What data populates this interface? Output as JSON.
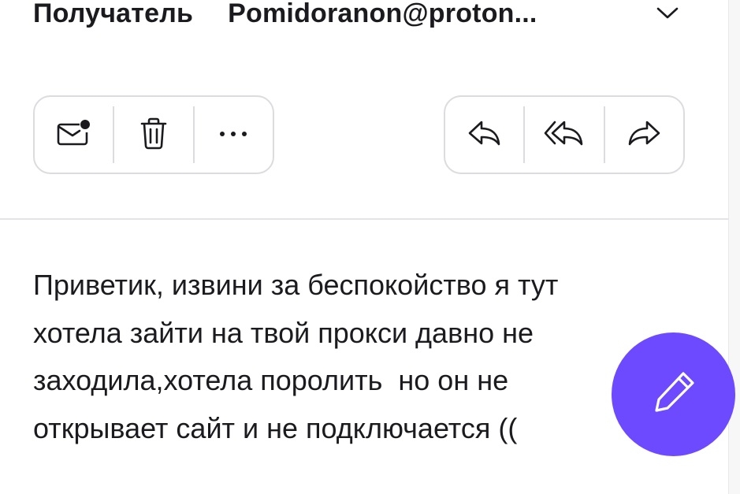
{
  "header": {
    "recipient_label": "Получатель",
    "recipient_value": "Pomidoranon@proton..."
  },
  "toolbar_left": {
    "icons": [
      "mark-unread-icon",
      "trash-icon",
      "more-options-icon"
    ],
    "more_label": "···"
  },
  "toolbar_right": {
    "icons": [
      "reply-icon",
      "reply-all-icon",
      "forward-icon"
    ]
  },
  "message": {
    "body": "Приветик, извини за беспокойство я тут\nхотела зайти на твой прокси давно не\nзаходила,хотела поролить  но он не\nоткрывает сайт и не подключается (("
  },
  "fab": {
    "icon": "compose-pencil-icon",
    "color": "#6d4aff"
  },
  "colors": {
    "accent": "#6d4aff",
    "text": "#1b1b1f",
    "border": "#dcdce0"
  }
}
